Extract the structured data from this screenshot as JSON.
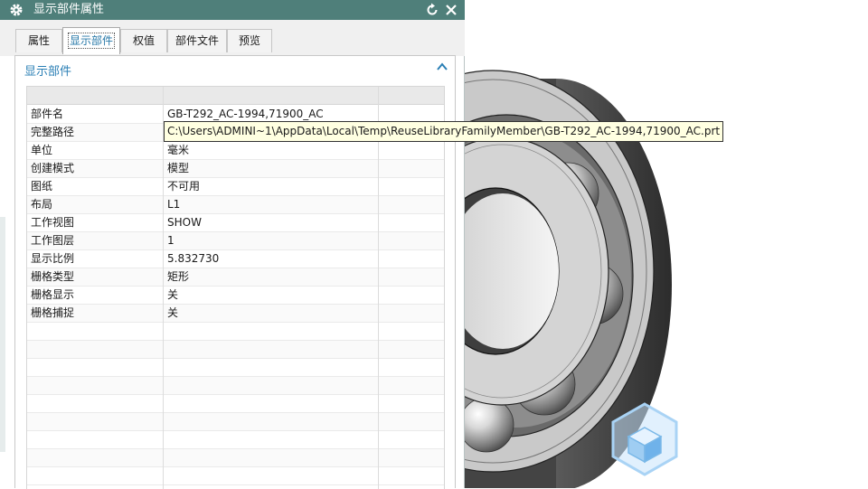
{
  "dialog": {
    "title": "显示部件属性",
    "tabs": [
      "属性",
      "显示部件",
      "权值",
      "部件文件",
      "预览"
    ],
    "active_tab": 1,
    "section_title": "显示部件",
    "rows": [
      {
        "label": "部件名",
        "value": "GB-T292_AC-1994,71900_AC"
      },
      {
        "label": "完整路径",
        "value": ""
      },
      {
        "label": "单位",
        "value": "毫米"
      },
      {
        "label": "创建模式",
        "value": "模型"
      },
      {
        "label": "图纸",
        "value": "不可用"
      },
      {
        "label": "布局",
        "value": "L1"
      },
      {
        "label": "工作视图",
        "value": "SHOW"
      },
      {
        "label": "工作图层",
        "value": "1"
      },
      {
        "label": "显示比例",
        "value": "5.832730"
      },
      {
        "label": "栅格类型",
        "value": "矩形"
      },
      {
        "label": "栅格显示",
        "value": "关"
      },
      {
        "label": "栅格捕捉",
        "value": "关"
      }
    ],
    "tooltip": "C:\\Users\\ADMINI~1\\AppData\\Local\\Temp\\ReuseLibraryFamilyMember\\GB-T292_AC-1994,71900_AC.prt"
  },
  "colors": {
    "titlebar": "#4f7f7a",
    "accent": "#2a7fb5",
    "tooltip_bg": "#ffffe1"
  },
  "icons": {
    "settings": "gear-icon",
    "reset": "reset-icon",
    "close": "close-icon",
    "collapse": "chevron-up-icon",
    "view_cube": "view-cube-icon"
  }
}
